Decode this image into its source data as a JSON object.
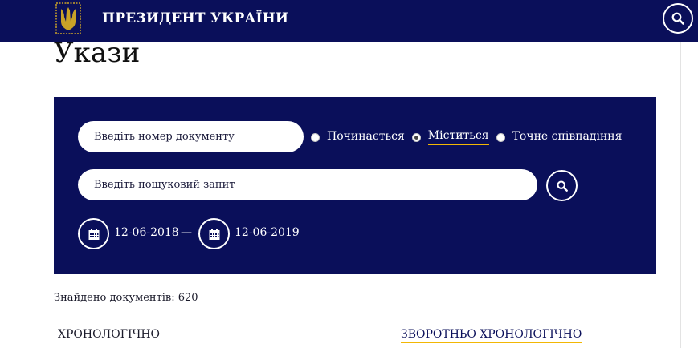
{
  "header": {
    "site_title": "ПРЕЗИДЕНТ УКРАЇНИ",
    "logo_icon": "trident-coat-of-arms-icon",
    "search_icon": "search-icon"
  },
  "page": {
    "title": "Укази"
  },
  "filters": {
    "doc_number_placeholder": "Введіть номер документу",
    "match_options": [
      {
        "label": "Починається",
        "selected": false
      },
      {
        "label": "Міститься",
        "selected": true
      },
      {
        "label": "Точне співпадіння",
        "selected": false
      }
    ],
    "query_placeholder": "Введіть пошуковий запит",
    "date_from": "12-06-2018",
    "date_separator": "—",
    "date_to": "12-06-2019",
    "calendar_icon": "calendar-icon"
  },
  "results": {
    "found_text": "Знайдено документів: 620"
  },
  "sorting": {
    "chronological": "ХРОНОЛОГІЧНО",
    "reverse_chronological": "ЗВОРОТНЬО ХРОНОЛОГІЧНО",
    "active": "reverse_chronological"
  },
  "colors": {
    "brand_navy": "#0a0f5a",
    "accent_gold": "#f2b705"
  }
}
